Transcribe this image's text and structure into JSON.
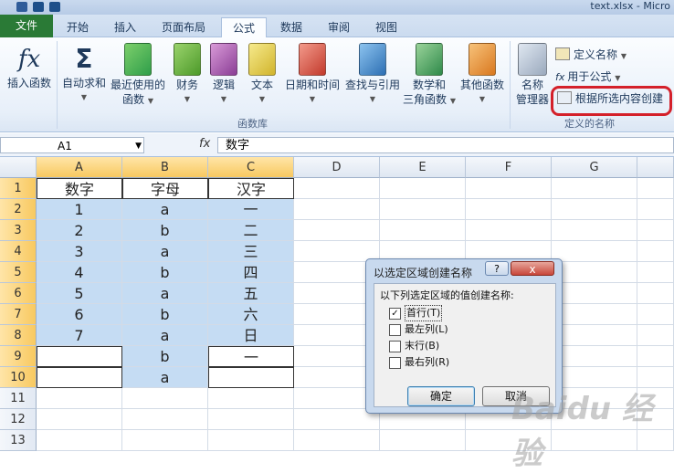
{
  "window": {
    "filename": "text.xlsx - Micro"
  },
  "tabs": [
    "文件",
    "开始",
    "插入",
    "页面布局",
    "公式",
    "数据",
    "审阅",
    "视图"
  ],
  "active_tab": "公式",
  "ribbon": {
    "function_library": {
      "group_label": "函数库",
      "insert_function": "插入函数",
      "autosum": "自动求和",
      "recent_line1": "最近使用的",
      "recent_line2": "函数",
      "financial": "财务",
      "logical": "逻辑",
      "text": "文本",
      "datetime": "日期和时间",
      "lookup": "查找与引用",
      "math_line1": "数学和",
      "math_line2": "三角函数",
      "more": "其他函数"
    },
    "defined_names": {
      "group_label": "定义的名称",
      "name_manager_line1": "名称",
      "name_manager_line2": "管理器",
      "define_name": "定义名称",
      "use_in_formula": "用于公式",
      "create_from_selection": "根据所选内容创建"
    }
  },
  "formula_bar": {
    "namebox": "A1",
    "fx": "fx",
    "content": "数字"
  },
  "columns": [
    "A",
    "B",
    "C",
    "D",
    "E",
    "F",
    "G"
  ],
  "rows": [
    "1",
    "2",
    "3",
    "4",
    "5",
    "6",
    "7",
    "8",
    "9",
    "10",
    "11",
    "12",
    "13"
  ],
  "cells": {
    "A": [
      "数字",
      "1",
      "2",
      "3",
      "4",
      "5",
      "6",
      "7",
      "",
      ""
    ],
    "B": [
      "字母",
      "a",
      "b",
      "a",
      "b",
      "a",
      "b",
      "a",
      "b",
      "a"
    ],
    "C": [
      "汉字",
      "一",
      "二",
      "三",
      "四",
      "五",
      "六",
      "日",
      "一",
      ""
    ]
  },
  "dialog": {
    "title": "以选定区域创建名称",
    "help": "?",
    "close": "x",
    "prompt": "以下列选定区域的值创建名称:",
    "options": [
      {
        "label": "首行(T)",
        "checked": true
      },
      {
        "label": "最左列(L)",
        "checked": false
      },
      {
        "label": "末行(B)",
        "checked": false
      },
      {
        "label": "最右列(R)",
        "checked": false
      }
    ],
    "ok": "确定",
    "cancel": "取消"
  },
  "watermark": "Baidu 经验",
  "colors": {
    "selection": "#c5dcf3",
    "highlight": "#d4202a",
    "file_tab": "#2a7a36"
  }
}
